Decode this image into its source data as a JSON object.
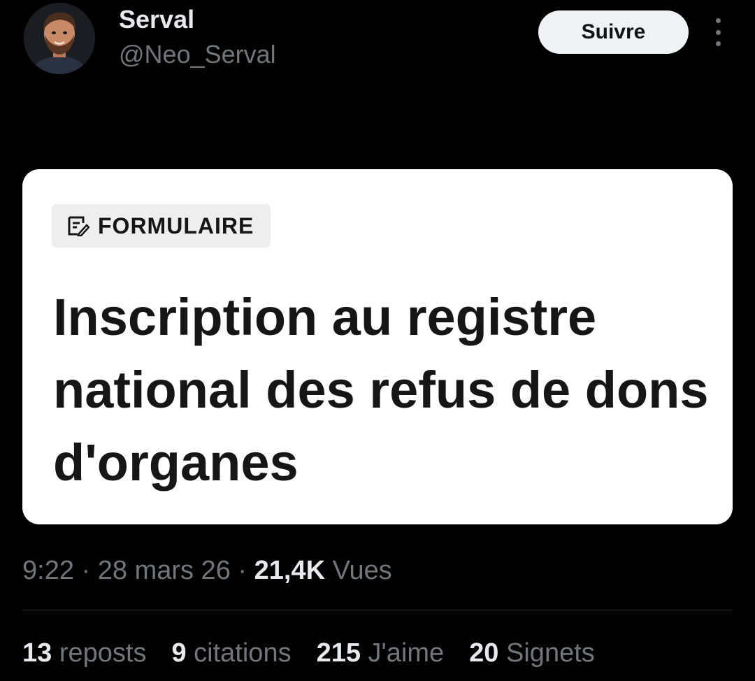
{
  "author": {
    "display_name": "Serval",
    "handle": "@Neo_Serval",
    "avatar_icon": "cartoon-man-avatar"
  },
  "actions": {
    "follow_label": "Suivre",
    "more_icon": "more-vertical-icon"
  },
  "media_card": {
    "badge_icon": "form-edit-icon",
    "badge_label": "FORMULAIRE",
    "title": "Inscription au registre national des refus de dons d'organes"
  },
  "meta": {
    "time": "9:22",
    "date": "28 mars 26",
    "views_count": "21,4K",
    "views_label": "Vues",
    "separator": " · "
  },
  "stats": [
    {
      "count": "13",
      "label": "reposts"
    },
    {
      "count": "9",
      "label": "citations"
    },
    {
      "count": "215",
      "label": "J'aime"
    },
    {
      "count": "20",
      "label": "Signets"
    }
  ],
  "colors": {
    "background": "#000000",
    "primary_text": "#e7e9ea",
    "secondary_text": "#71767b",
    "follow_button_bg": "#eff3f4",
    "card_bg": "#ffffff",
    "divider": "#2f3336"
  }
}
